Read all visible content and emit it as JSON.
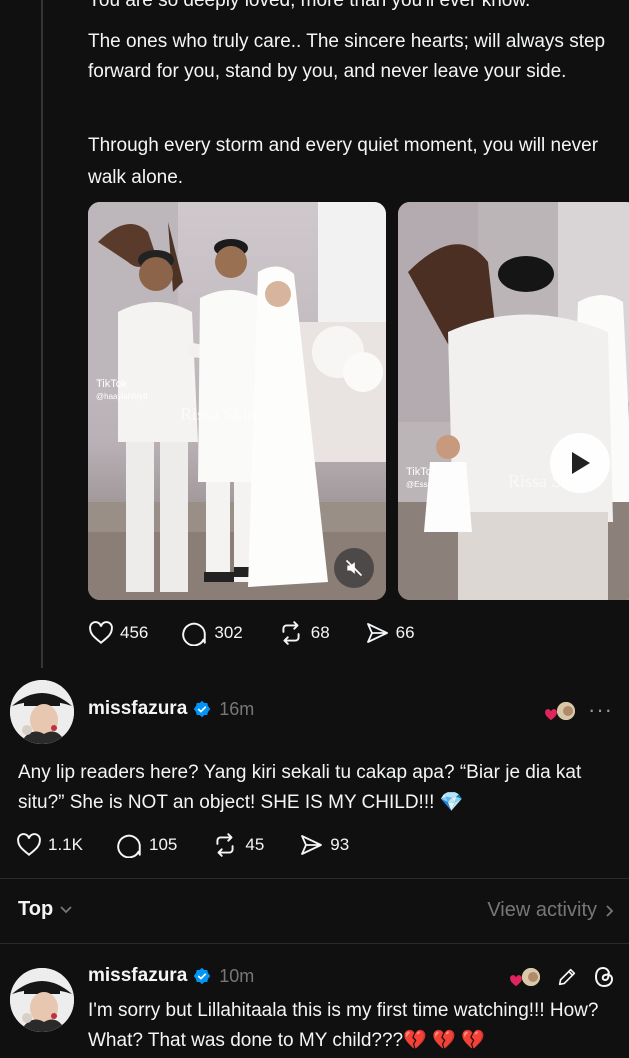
{
  "post1": {
    "cut_line": "You are so deeply loved, more than you'll ever know.",
    "paragraph1": "The ones who truly care.. The sincere hearts; will always step forward for you, stand by you, and never leave your side.",
    "paragraph2": "Through every storm and every quiet moment, you will never walk alone.",
    "media": [
      {
        "watermark_app": "TikTok",
        "watermark_user": "@haaylahhrytl",
        "overlay_text": "Rissa Skin"
      },
      {
        "watermark_app": "TikTok",
        "watermark_user": "@Essayamtiyaz",
        "overlay_text": "Rissa Skin"
      }
    ],
    "stats": {
      "likes": "456",
      "replies": "302",
      "reposts": "68",
      "shares": "66"
    }
  },
  "post2": {
    "username": "missfazura",
    "time": "16m",
    "text": "Any lip readers here? Yang kiri sekali tu cakap apa? “Biar je dia kat situ?” She is NOT an object! SHE IS MY CHILD!!! 💎",
    "stats": {
      "likes": "1.1K",
      "replies": "105",
      "reposts": "45",
      "shares": "93"
    },
    "more": "···"
  },
  "replies_header": {
    "sort_label": "Top",
    "view_activity_label": "View activity"
  },
  "reply1": {
    "username": "missfazura",
    "time": "10m",
    "text": "I'm sorry but Lillahitaala this is my first time watching!!! How? What? That was done to MY child???💔 💔 💔"
  },
  "colors": {
    "background": "#101010",
    "text": "#f3f5f7",
    "muted": "#777777",
    "verified": "#0095f6",
    "heart": "#e0245e"
  }
}
